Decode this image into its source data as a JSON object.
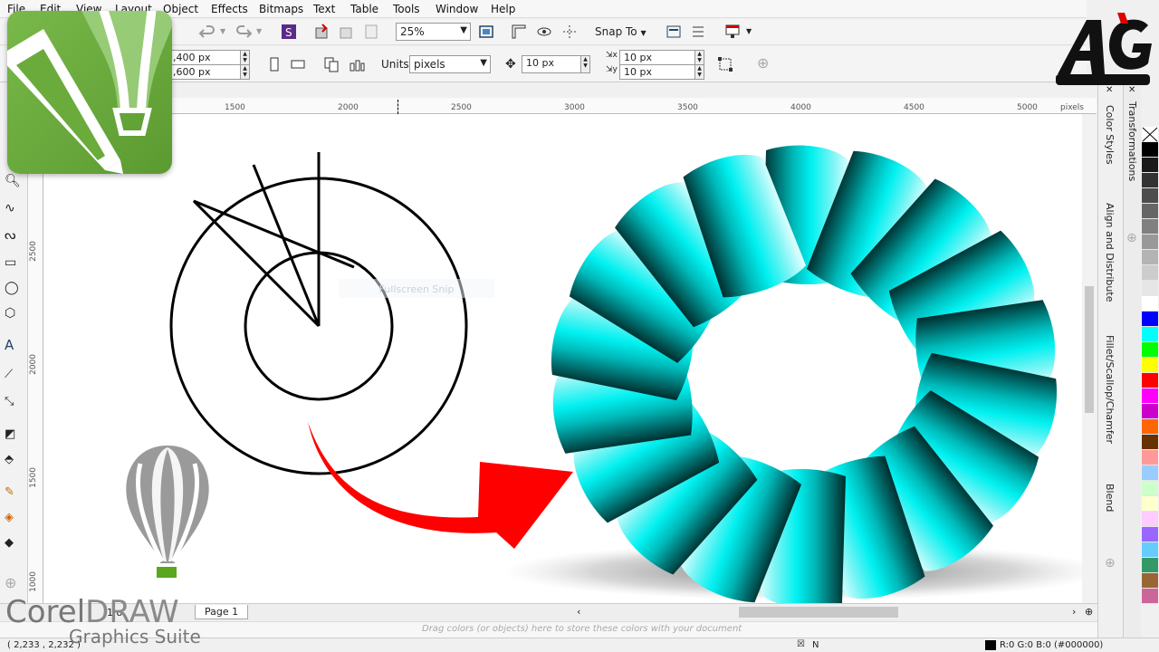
{
  "menu": [
    "File",
    "Edit",
    "View",
    "Layout",
    "Object",
    "Effects",
    "Bitmaps",
    "Text",
    "Table",
    "Tools",
    "Window",
    "Help"
  ],
  "toolbar1": {
    "zoom_value": "25%",
    "snap_label": "Snap To"
  },
  "toolbar2": {
    "width_value": ",400 px",
    "height_value": ",600 px",
    "units_label": "Units:",
    "units_value": "pixels",
    "nudge_value": "10 px",
    "dup_x_value": "10 px",
    "dup_y_value": "10 px"
  },
  "ruler": {
    "h_labels": [
      "1500",
      "2000",
      "2500",
      "3000",
      "3500",
      "4000",
      "4500",
      "5000"
    ],
    "h_unit": "pixels",
    "v_labels": [
      "2500",
      "2000",
      "1500",
      "1000"
    ],
    "v_unit": "pixels"
  },
  "canvas": {
    "ghost_text": "Fullscreen Snip"
  },
  "pagebar": {
    "page_counter": "1 o",
    "page_tab": "Page 1"
  },
  "colorwell": {
    "hint": "Drag colors (or objects) here to store these colors with your document"
  },
  "status": {
    "coords": "( 2,233 , 2,232 )",
    "fill_info": "R:0 G:0 B:0 (#000000)",
    "fill_none": "N"
  },
  "dockers": {
    "color_styles": "Color Styles",
    "align_distribute": "Align and Distribute",
    "fillet": "Fillet/Scallop/Chamfer",
    "blend": "Blend",
    "transformations": "Transformations"
  },
  "branding": {
    "corel": "Corel",
    "draw": "DRAW",
    "suite": "Graphics Suite"
  },
  "palette_colors": [
    "#ffffff",
    "#000000",
    "#1a1a1a",
    "#333333",
    "#4d4d4d",
    "#666666",
    "#808080",
    "#999999",
    "#b3b3b3",
    "#cccccc",
    "#e6e6e6",
    "#ffffff",
    "#0000ff",
    "#00ffff",
    "#00ff00",
    "#ffff00",
    "#ff0000",
    "#ff00ff",
    "#cc00cc",
    "#ff6600",
    "#663300",
    "#ff9999",
    "#99ccff",
    "#ccffcc",
    "#ffffcc",
    "#ffccff",
    "#9966ff",
    "#66ccff",
    "#339966",
    "#996633",
    "#cc6699"
  ],
  "accent_colors": {
    "corel_green": "#6aab3c",
    "arrow_red": "#ff0000",
    "torus_cyan": "#00e5e5"
  }
}
